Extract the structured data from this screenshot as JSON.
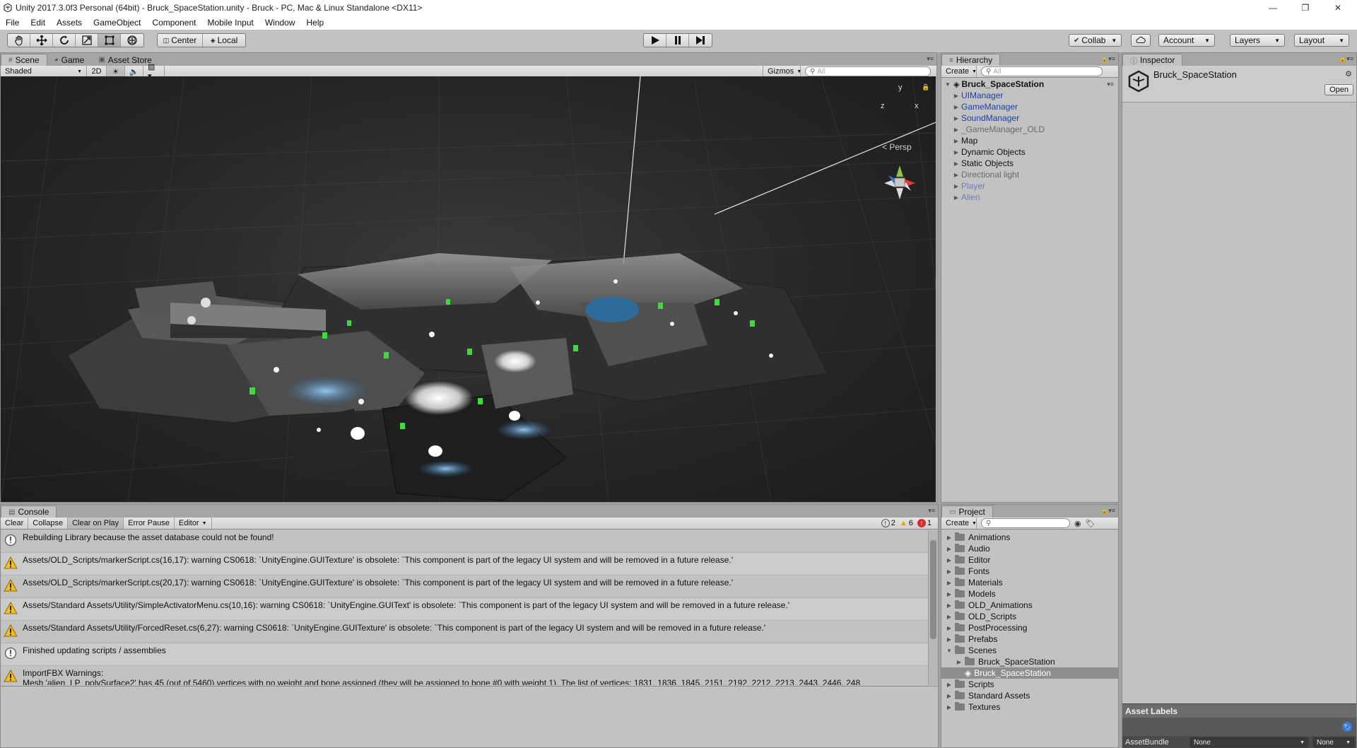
{
  "window": {
    "title": "Unity 2017.3.0f3 Personal (64bit) - Bruck_SpaceStation.unity - Bruck - PC, Mac & Linux Standalone <DX11>",
    "minimize": "—",
    "maximize": "❐",
    "close": "✕"
  },
  "menu": [
    "File",
    "Edit",
    "Assets",
    "GameObject",
    "Component",
    "Mobile Input",
    "Window",
    "Help"
  ],
  "toolbar": {
    "pivot": "Center",
    "space": "Local",
    "collab": "Collab",
    "account": "Account",
    "layers": "Layers",
    "layout": "Layout",
    "tools": [
      "hand-tool-icon",
      "move-tool-icon",
      "rotate-tool-icon",
      "scale-tool-icon",
      "rect-tool-icon",
      "transform-tool-icon"
    ],
    "active_tool": "rect-tool-icon"
  },
  "scene_panel": {
    "tabs": [
      "Scene",
      "Game",
      "Asset Store"
    ],
    "active_tab": "Scene",
    "shading": "Shaded",
    "mode_2d": "2D",
    "gizmos": "Gizmos",
    "search_placeholder": "All",
    "persp_label": "< Persp",
    "axis_y": "y",
    "axis_x": "x",
    "axis_z": "z"
  },
  "hierarchy": {
    "tab": "Hierarchy",
    "create": "Create",
    "search_placeholder": "All",
    "scene": "Bruck_SpaceStation",
    "items": [
      {
        "label": "UIManager",
        "color": "#1a3fa8"
      },
      {
        "label": "GameManager",
        "color": "#1a3fa8"
      },
      {
        "label": "SoundManager",
        "color": "#1a3fa8"
      },
      {
        "label": "_GameManager_OLD",
        "color": "#6a6a6a"
      },
      {
        "label": "Map",
        "color": "#111111"
      },
      {
        "label": "Dynamic Objects",
        "color": "#111111"
      },
      {
        "label": "Static Objects",
        "color": "#111111"
      },
      {
        "label": "Directional light",
        "color": "#6a6a6a"
      },
      {
        "label": "Player",
        "color": "#6a7ec4"
      },
      {
        "label": "Alien",
        "color": "#6a7ec4"
      }
    ]
  },
  "inspector": {
    "tab": "Inspector",
    "asset_name": "Bruck_SpaceStation",
    "open": "Open",
    "asset_labels": "Asset Labels",
    "asset_bundle_label": "AssetBundle",
    "asset_bundle_value": "None",
    "asset_bundle_variant": "None"
  },
  "console": {
    "tab": "Console",
    "buttons": [
      "Clear",
      "Collapse",
      "Clear on Play",
      "Error Pause",
      "Editor"
    ],
    "active_buttons": [
      "Clear on Play"
    ],
    "count_info": "2",
    "count_warn": "6",
    "count_error": "1",
    "rows": [
      {
        "type": "info",
        "line1": "Rebuilding Library because the asset database could not be found!",
        "line2": ""
      },
      {
        "type": "warn",
        "line1": "Assets/OLD_Scripts/markerScript.cs(16,17): warning CS0618: `UnityEngine.GUITexture' is obsolete: `This component is part of the legacy UI system and will be removed in a future release.'",
        "line2": ""
      },
      {
        "type": "warn",
        "line1": "Assets/OLD_Scripts/markerScript.cs(20,17): warning CS0618: `UnityEngine.GUITexture' is obsolete: `This component is part of the legacy UI system and will be removed in a future release.'",
        "line2": ""
      },
      {
        "type": "warn",
        "line1": "Assets/Standard Assets/Utility/SimpleActivatorMenu.cs(10,16): warning CS0618: `UnityEngine.GUIText' is obsolete: `This component is part of the legacy UI system and will be removed in a future release.'",
        "line2": ""
      },
      {
        "type": "warn",
        "line1": "Assets/Standard Assets/Utility/ForcedReset.cs(6,27): warning CS0618: `UnityEngine.GUITexture' is obsolete: `This component is part of the legacy UI system and will be removed in a future release.'",
        "line2": ""
      },
      {
        "type": "info",
        "line1": "Finished updating scripts / assemblies",
        "line2": ""
      },
      {
        "type": "warn",
        "line1": "ImportFBX Warnings:",
        "line2": "Mesh 'alien_LP_polySurface2' has 45 (out of 5460) vertices with no weight and bone assigned (they will be assigned to bone #0 with weight 1). The list of vertices: 1831, 1836, 1845, 2151, 2192, 2212, 2213, 2443, 2446, 248"
      }
    ]
  },
  "project": {
    "tab": "Project",
    "create": "Create",
    "folders": [
      {
        "label": "Animations",
        "depth": 0,
        "expanded": false,
        "kind": "folder"
      },
      {
        "label": "Audio",
        "depth": 0,
        "expanded": false,
        "kind": "folder"
      },
      {
        "label": "Editor",
        "depth": 0,
        "expanded": false,
        "kind": "folder"
      },
      {
        "label": "Fonts",
        "depth": 0,
        "expanded": false,
        "kind": "folder"
      },
      {
        "label": "Materials",
        "depth": 0,
        "expanded": false,
        "kind": "folder"
      },
      {
        "label": "Models",
        "depth": 0,
        "expanded": false,
        "kind": "folder"
      },
      {
        "label": "OLD_Animations",
        "depth": 0,
        "expanded": false,
        "kind": "folder"
      },
      {
        "label": "OLD_Scripts",
        "depth": 0,
        "expanded": false,
        "kind": "folder"
      },
      {
        "label": "PostProcessing",
        "depth": 0,
        "expanded": false,
        "kind": "folder"
      },
      {
        "label": "Prefabs",
        "depth": 0,
        "expanded": false,
        "kind": "folder"
      },
      {
        "label": "Scenes",
        "depth": 0,
        "expanded": true,
        "kind": "folder"
      },
      {
        "label": "Bruck_SpaceStation",
        "depth": 1,
        "expanded": false,
        "kind": "folder"
      },
      {
        "label": "Bruck_SpaceStation",
        "depth": 1,
        "expanded": false,
        "kind": "scene",
        "selected": true
      },
      {
        "label": "Scripts",
        "depth": 0,
        "expanded": false,
        "kind": "folder"
      },
      {
        "label": "Standard Assets",
        "depth": 0,
        "expanded": false,
        "kind": "folder"
      },
      {
        "label": "Textures",
        "depth": 0,
        "expanded": false,
        "kind": "folder"
      }
    ]
  }
}
